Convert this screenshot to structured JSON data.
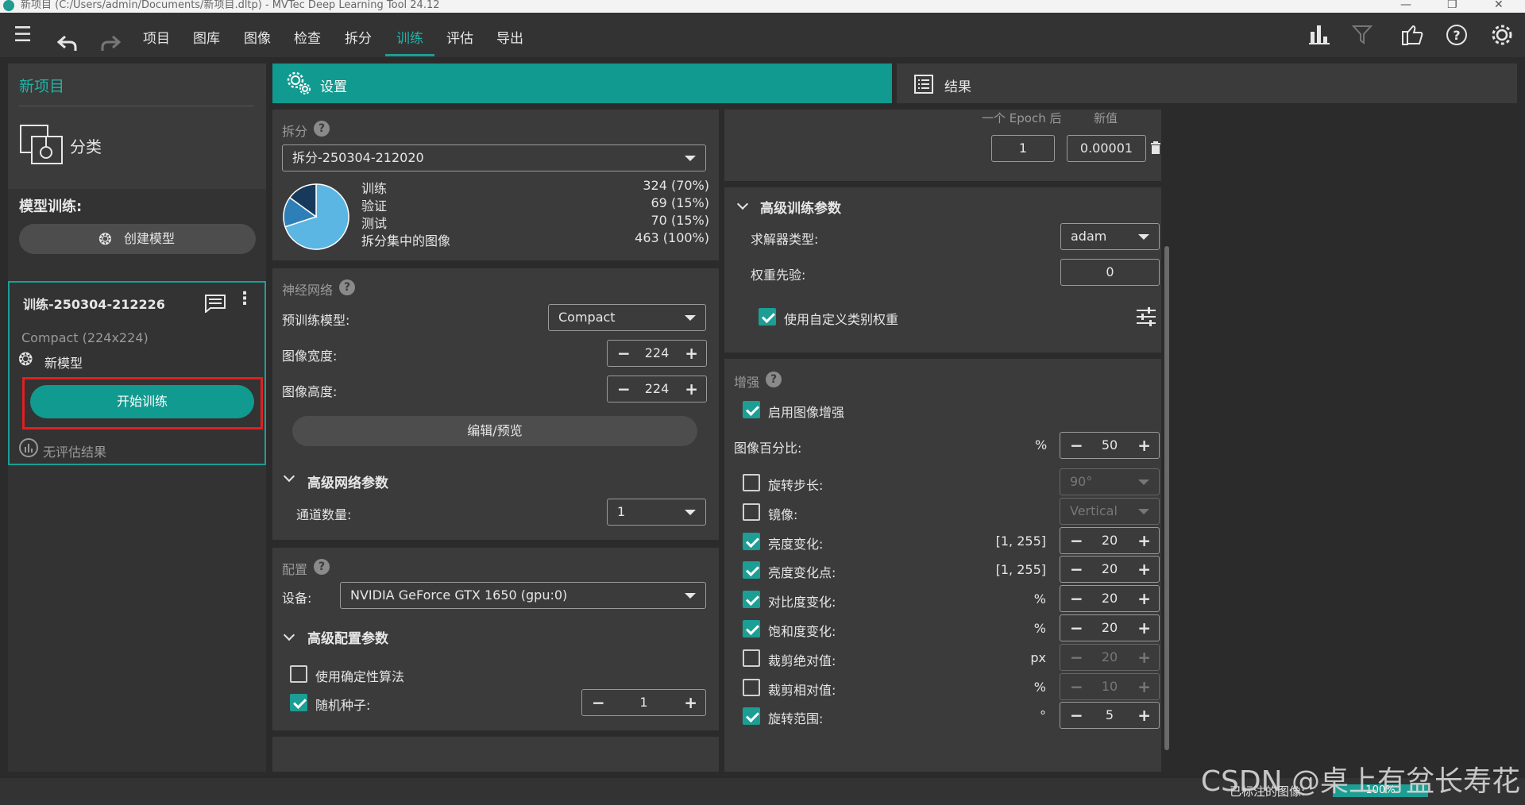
{
  "window": {
    "title": "新项目 (C:/Users/admin/Documents/新项目.dltp) - MVTec Deep Learning Tool 24.12",
    "controls": [
      "—",
      "❐",
      "✕"
    ]
  },
  "menu": {
    "items": [
      "项目",
      "图库",
      "图像",
      "检查",
      "拆分",
      "训练",
      "评估",
      "导出"
    ],
    "active": "训练"
  },
  "project": {
    "name": "新项目",
    "type": "分类"
  },
  "training": {
    "section_title": "模型训练:",
    "create_model": "创建模型",
    "card": {
      "name": "训练-250304-212226",
      "model_info": "Compact (224x224)",
      "model_label": "新模型",
      "start_button": "开始训练",
      "no_eval": "无评估结果"
    }
  },
  "tabs": {
    "settings": "设置",
    "results": "结果"
  },
  "split": {
    "title": "拆分",
    "selected": "拆分-250304-212020",
    "rows": [
      {
        "label": "训练",
        "value": "324 (70%)"
      },
      {
        "label": "验证",
        "value": "69 (15%)"
      },
      {
        "label": "测试",
        "value": "70 (15%)"
      },
      {
        "label": "拆分集中的图像",
        "value": "463 (100%)"
      }
    ],
    "pie": [
      {
        "name": "训练",
        "fraction": 0.7,
        "color": "#5bb6e3"
      },
      {
        "name": "验证",
        "fraction": 0.15,
        "color": "#2e7fb8"
      },
      {
        "name": "测试",
        "fraction": 0.15,
        "color": "#173a5c"
      }
    ]
  },
  "network": {
    "title": "神经网络",
    "pretrained_label": "预训练模型:",
    "pretrained_value": "Compact",
    "width_label": "图像宽度:",
    "width_value": "224",
    "height_label": "图像高度:",
    "height_value": "224",
    "edit_button": "编辑/预览",
    "advanced_title": "高级网络参数",
    "channels_label": "通道数量:",
    "channels_value": "1"
  },
  "config": {
    "title": "配置",
    "device_label": "设备:",
    "device_value": "NVIDIA GeForce GTX 1650 (gpu:0)",
    "advanced_title": "高级配置参数",
    "deterministic_label": "使用确定性算法",
    "deterministic_checked": false,
    "seed_label": "随机种子:",
    "seed_checked": true,
    "seed_value": "1"
  },
  "schedule": {
    "col_epoch": "一个 Epoch 后",
    "col_value": "新值",
    "epoch_value": "1",
    "new_value": "0.00001"
  },
  "advanced_training": {
    "title": "高级训练参数",
    "solver_label": "求解器类型:",
    "solver_value": "adam",
    "weight_prior_label": "权重先验:",
    "weight_prior_value": "0",
    "custom_weights_label": "使用自定义类别权重",
    "custom_weights_checked": true
  },
  "augmentation": {
    "title": "增强",
    "enable_label": "启用图像增强",
    "enable_checked": true,
    "percent_label": "图像百分比:",
    "percent_unit": "%",
    "percent_value": "50",
    "rows": [
      {
        "label": "旋转步长:",
        "checked": false,
        "kind": "dropdown",
        "value": "90°",
        "unit": ""
      },
      {
        "label": "镜像:",
        "checked": false,
        "kind": "dropdown",
        "value": "Vertical",
        "unit": ""
      },
      {
        "label": "亮度变化:",
        "checked": true,
        "kind": "stepper",
        "value": "20",
        "unit": "[1, 255]"
      },
      {
        "label": "亮度变化点:",
        "checked": true,
        "kind": "stepper",
        "value": "20",
        "unit": "[1, 255]"
      },
      {
        "label": "对比度变化:",
        "checked": true,
        "kind": "stepper",
        "value": "20",
        "unit": "%"
      },
      {
        "label": "饱和度变化:",
        "checked": true,
        "kind": "stepper",
        "value": "20",
        "unit": "%"
      },
      {
        "label": "裁剪绝对值:",
        "checked": false,
        "kind": "stepper",
        "value": "20",
        "unit": "px"
      },
      {
        "label": "裁剪相对值:",
        "checked": false,
        "kind": "stepper",
        "value": "10",
        "unit": "%"
      },
      {
        "label": "旋转范围:",
        "checked": true,
        "kind": "stepper",
        "value": "5",
        "unit": "°"
      }
    ]
  },
  "status": {
    "labeled_label": "已标注的图像:",
    "labeled_value": "100%",
    "labeled_fraction": 1.0
  },
  "watermark": "CSDN @桌上有盆长寿花",
  "colors": {
    "accent": "#1c9e94",
    "accent_text": "#22b3a6",
    "highlight_box": "#e02020"
  }
}
